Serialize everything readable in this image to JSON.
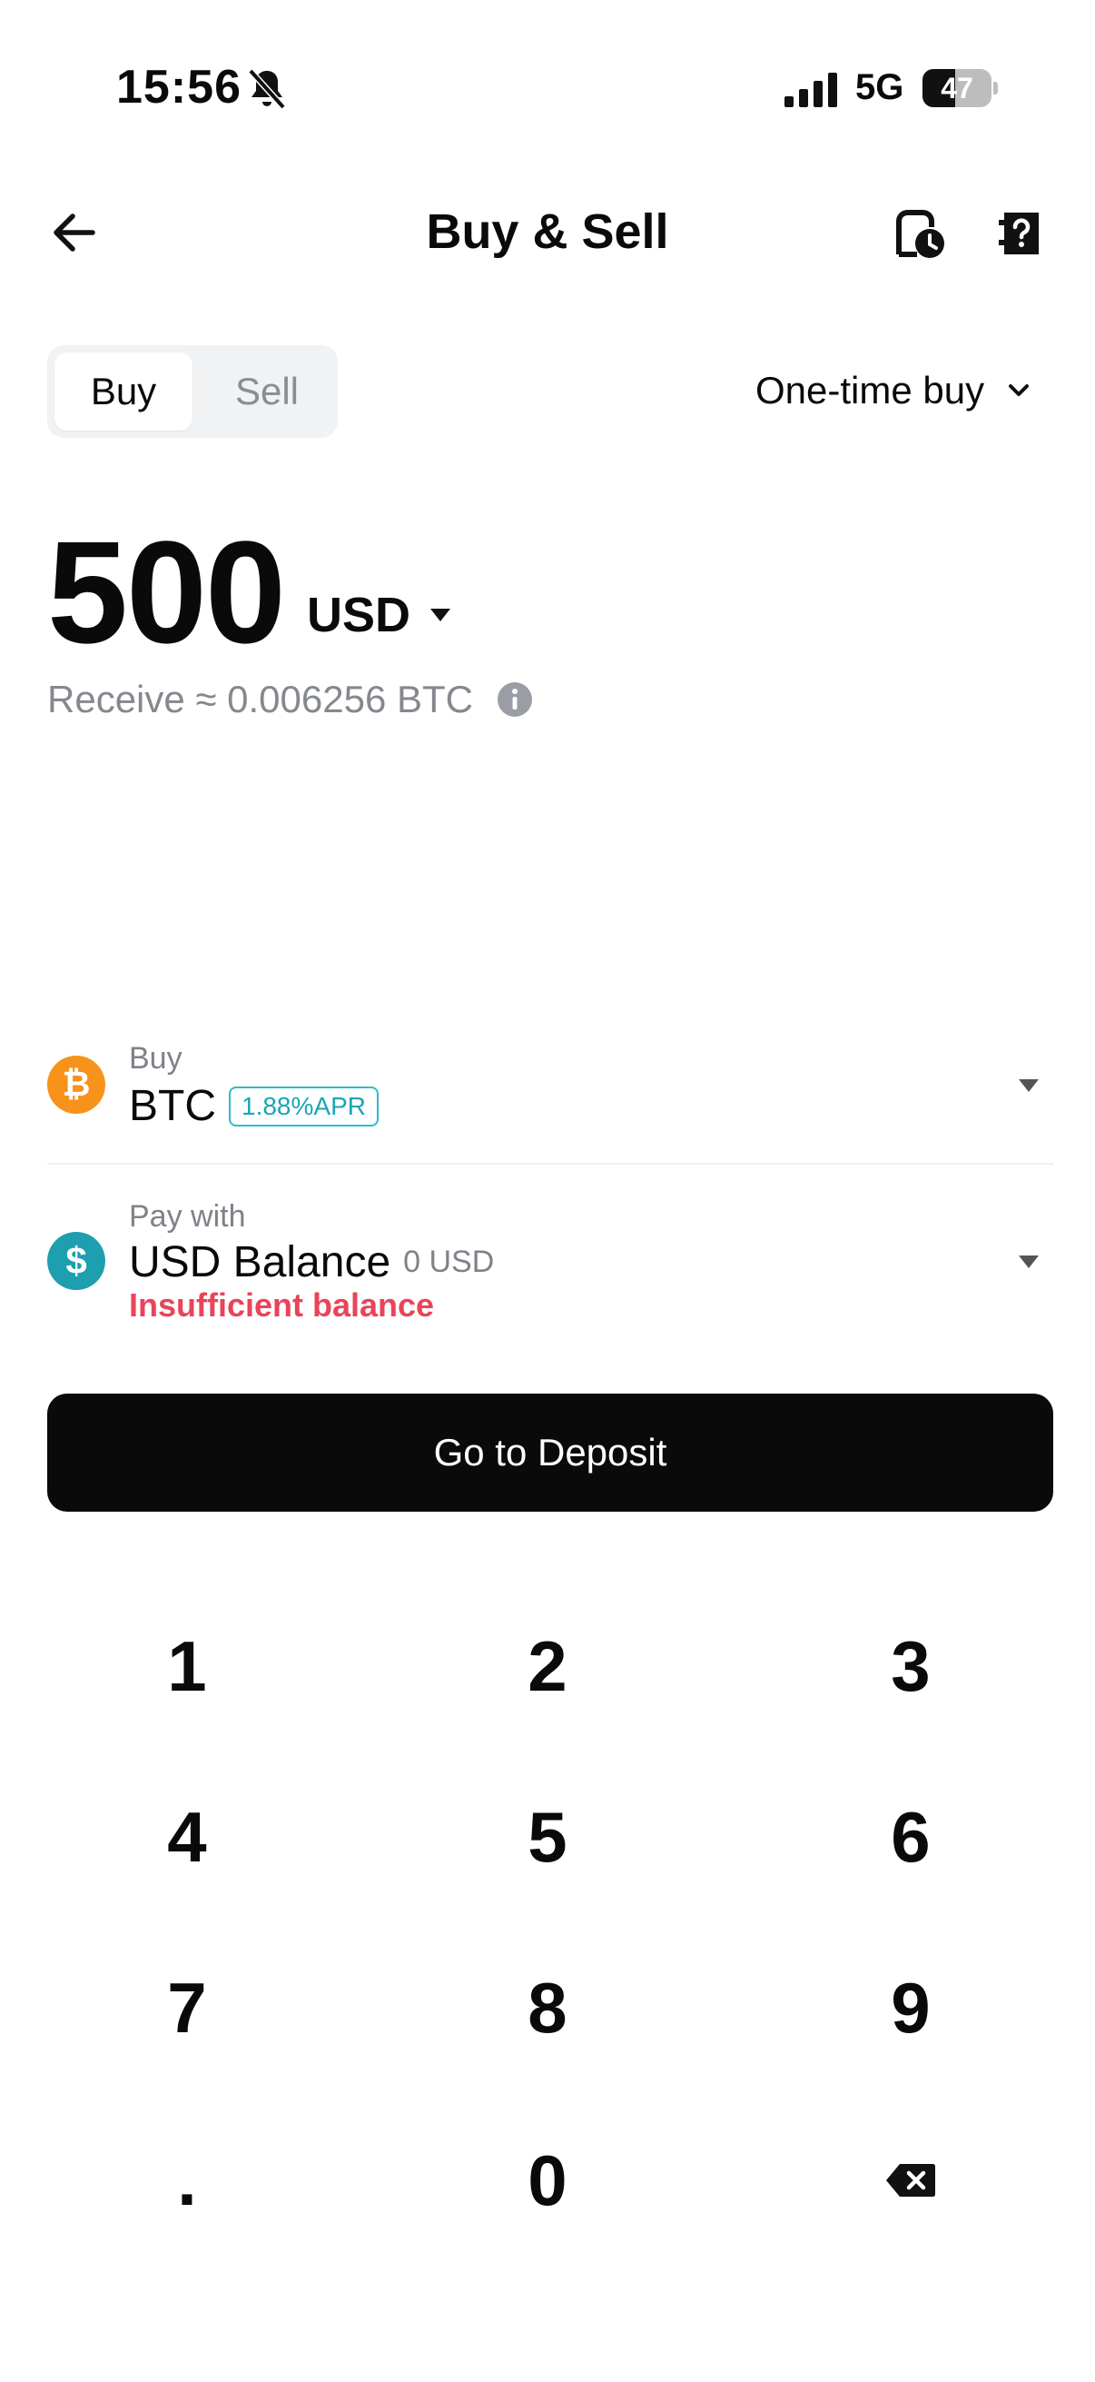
{
  "status_bar": {
    "time": "15:56",
    "network": "5G",
    "battery_percent": "47",
    "battery_level": 0.47
  },
  "header": {
    "title": "Buy & Sell",
    "icons": [
      "arrow-left-icon",
      "history-icon",
      "help-icon"
    ]
  },
  "mode_toggle": {
    "buy_label": "Buy",
    "sell_label": "Sell",
    "selected": "Buy"
  },
  "order_type": {
    "label": "One-time buy"
  },
  "amount": {
    "value": "500",
    "currency": "USD",
    "receive_text": "Receive ≈ 0.006256 BTC"
  },
  "buy_asset": {
    "label": "Buy",
    "asset": "BTC",
    "apr_badge": "1.88%APR",
    "icon_glyph": "₿"
  },
  "pay_with": {
    "label": "Pay with",
    "source": "USD Balance",
    "balance": "0 USD",
    "warning": "Insufficient balance",
    "icon_glyph": "$"
  },
  "cta": {
    "label": "Go to Deposit"
  },
  "keypad": {
    "keys": [
      "1",
      "2",
      "3",
      "4",
      "5",
      "6",
      "7",
      "8",
      "9",
      ".",
      "0"
    ]
  },
  "colors": {
    "accent_teal": "#1aa5b5",
    "btc_orange": "#f7931a",
    "usd_teal": "#1e9fb0",
    "warning_red": "#e8445a",
    "button_black": "#0a0a0a"
  }
}
